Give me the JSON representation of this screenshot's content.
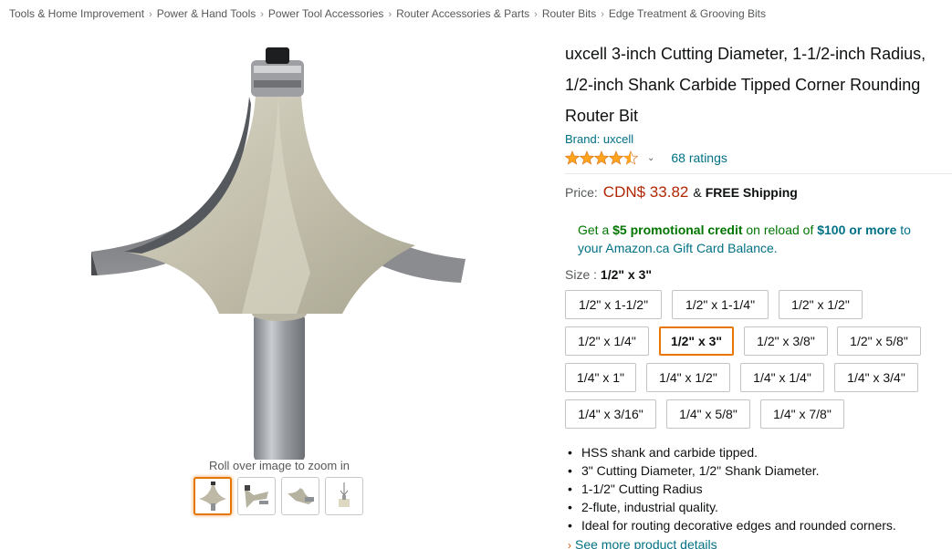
{
  "breadcrumb": [
    "Tools & Home Improvement",
    "Power & Hand Tools",
    "Power Tool Accessories",
    "Router Accessories & Parts",
    "Router Bits",
    "Edge Treatment & Grooving Bits"
  ],
  "breadcrumb_separator": "›",
  "gallery": {
    "zoom_hint": "Roll over image to zoom in",
    "active_thumb": 0
  },
  "product": {
    "title": "uxcell 3-inch Cutting Diameter, 1-1/2-inch Radius, 1/2-inch Shank Carbide Tipped Corner Rounding Router Bit",
    "brand": "Brand: uxcell",
    "rating": 4.5,
    "rating_chevron": "⌄",
    "ratings_count": "68 ratings"
  },
  "price": {
    "label": "Price:",
    "value": "CDN$ 33.82",
    "amp": "&",
    "shipping": "FREE Shipping"
  },
  "promo": {
    "part1": "Get a ",
    "credit": "$5 promotional credit",
    "part2": " on reload of ",
    "amount": "$100 or more",
    "part3": " to",
    "part4": "your Amazon.ca Gift Card Balance."
  },
  "size": {
    "label": "Size : ",
    "selected": "1/2\" x 3\"",
    "options": [
      "1/2\" x 1-1/2\"",
      "1/2\" x 1-1/4\"",
      "1/2\" x 1/2\"",
      "1/2\" x 1/4\"",
      "1/2\" x 3\"",
      "1/2\" x 3/8\"",
      "1/2\" x 5/8\"",
      "1/4\" x 1\"",
      "1/4\" x 1/2\"",
      "1/4\" x 1/4\"",
      "1/4\" x 3/4\"",
      "1/4\" x 3/16\"",
      "1/4\" x 5/8\"",
      "1/4\" x 7/8\""
    ]
  },
  "bullets": [
    "HSS shank and carbide tipped.",
    "3\" Cutting Diameter, 1/2\" Shank Diameter.",
    "1-1/2\" Cutting Radius",
    "2-flute, industrial quality.",
    "Ideal for routing decorative edges and rounded corners."
  ],
  "see_more": "See more product details",
  "colors": {
    "price": "#b12704",
    "link": "#007185",
    "promo_green": "#007600",
    "selected_border": "#e77600",
    "star": "#ffa41c"
  }
}
